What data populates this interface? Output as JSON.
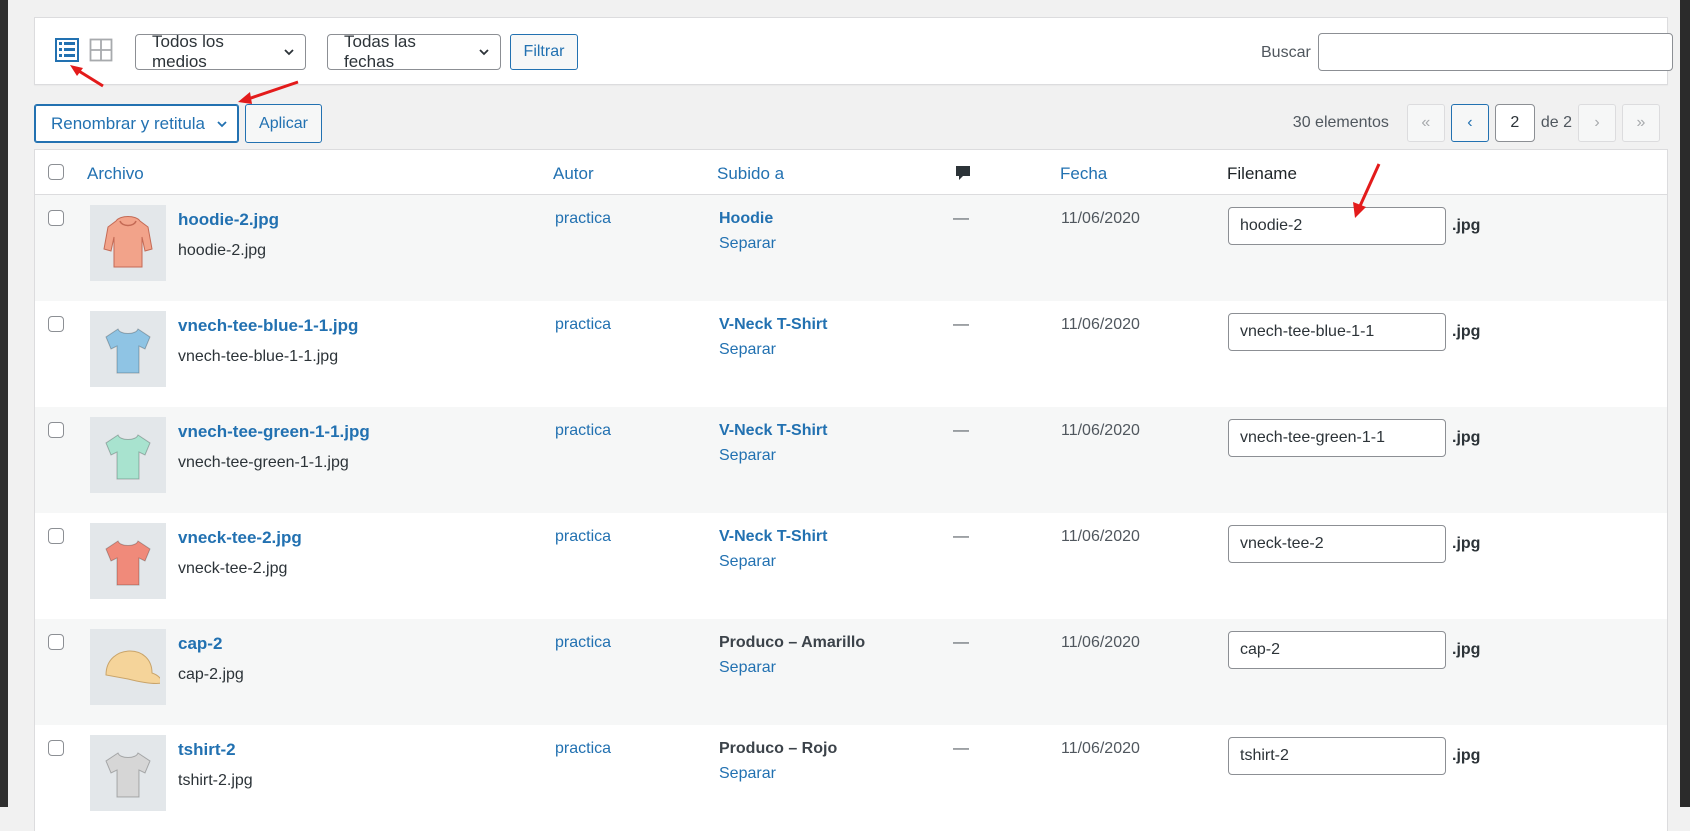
{
  "toolbar": {
    "media_type_select": "Todos los medios",
    "date_select": "Todas las fechas",
    "filter_button": "Filtrar",
    "search_label": "Buscar",
    "search_value": ""
  },
  "bulk": {
    "action_select": "Renombrar y retitula",
    "apply_button": "Aplicar"
  },
  "pagination": {
    "count": "30 elementos",
    "first": "«",
    "prev": "‹",
    "current_page": "2",
    "of_total": "de 2",
    "next": "›",
    "last": "»"
  },
  "columns": {
    "file": "Archivo",
    "author": "Autor",
    "uploaded_to": "Subido a",
    "date": "Fecha",
    "filename": "Filename"
  },
  "rows": [
    {
      "title": "hoodie-2.jpg",
      "file": "hoodie-2.jpg",
      "author": "practica",
      "parent": "Hoodie",
      "detach": "Separar",
      "comments": "—",
      "date": "11/06/2020",
      "filename": "hoodie-2",
      "ext": ".jpg",
      "thumb_color": "#f2a38a"
    },
    {
      "title": "vnech-tee-blue-1-1.jpg",
      "file": "vnech-tee-blue-1-1.jpg",
      "author": "practica",
      "parent": "V-Neck T-Shirt",
      "detach": "Separar",
      "comments": "—",
      "date": "11/06/2020",
      "filename": "vnech-tee-blue-1-1",
      "ext": ".jpg",
      "thumb_color": "#8fc4e4"
    },
    {
      "title": "vnech-tee-green-1-1.jpg",
      "file": "vnech-tee-green-1-1.jpg",
      "author": "practica",
      "parent": "V-Neck T-Shirt",
      "detach": "Separar",
      "comments": "—",
      "date": "11/06/2020",
      "filename": "vnech-tee-green-1-1",
      "ext": ".jpg",
      "thumb_color": "#a8e3cf"
    },
    {
      "title": "vneck-tee-2.jpg",
      "file": "vneck-tee-2.jpg",
      "author": "practica",
      "parent": "V-Neck T-Shirt",
      "detach": "Separar",
      "comments": "—",
      "date": "11/06/2020",
      "filename": "vneck-tee-2",
      "ext": ".jpg",
      "thumb_color": "#f08a7a"
    },
    {
      "title": "cap-2",
      "file": "cap-2.jpg",
      "author": "practica",
      "parent": "Produco – Amarillo",
      "detach": "Separar",
      "comments": "—",
      "date": "11/06/2020",
      "filename": "cap-2",
      "ext": ".jpg",
      "thumb_color": "#f5d49a"
    },
    {
      "title": "tshirt-2",
      "file": "tshirt-2.jpg",
      "author": "practica",
      "parent": "Produco – Rojo",
      "detach": "Separar",
      "comments": "—",
      "date": "11/06/2020",
      "filename": "tshirt-2",
      "ext": ".jpg",
      "thumb_color": "#d6d6d6"
    }
  ],
  "colors": {
    "accent": "#2271b1",
    "annotation_arrow": "#e31b1b"
  }
}
